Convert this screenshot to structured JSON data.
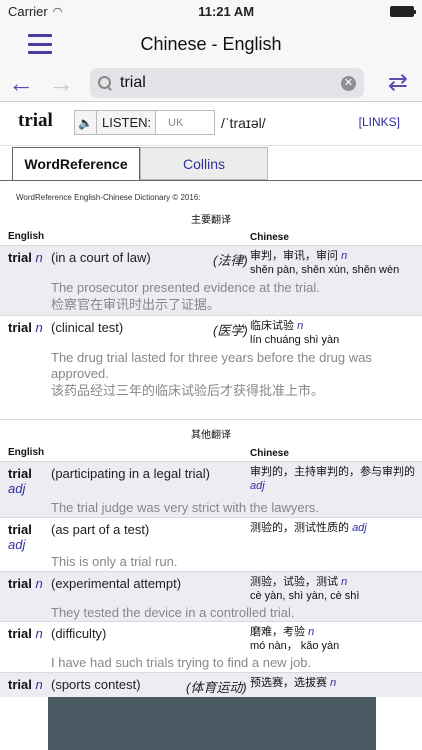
{
  "status": {
    "carrier": "Carrier",
    "time": "11:21 AM"
  },
  "nav": {
    "title": "Chinese - English"
  },
  "search": {
    "query": "trial"
  },
  "headword": {
    "word": "trial",
    "listen_label": "LISTEN:",
    "accent": "UK",
    "ipa": "/ˈtraɪəl/",
    "links": "[LINKS]"
  },
  "tabs": [
    {
      "label": "WordReference"
    },
    {
      "label": "Collins"
    }
  ],
  "credit": "WordReference English-Chinese Dictionary © 2016:",
  "main_section": {
    "title": "主要翻译",
    "col_en": "English",
    "col_zh": "Chinese",
    "entries": [
      {
        "term": "trial",
        "pos": "n",
        "sense": "(in a court of law)",
        "domain": "(法律)",
        "zh": "审判，审讯，审问",
        "zh_pos": "n",
        "pinyin": "shěn pàn, shěn xùn, shěn wèn",
        "example_en": "The prosecutor presented evidence at the trial.",
        "example_zh": "检察官在审讯时出示了证据。"
      },
      {
        "term": "trial",
        "pos": "n",
        "sense": "(clinical test)",
        "domain": "(医学)",
        "zh": "临床试验",
        "zh_pos": "n",
        "pinyin": "lín chuáng shì yàn",
        "example_en": "The drug trial lasted for three years before the drug was approved.",
        "example_zh": "该药品经过三年的临床试验后才获得批准上市。"
      }
    ]
  },
  "other_section": {
    "title": "其他翻译",
    "col_en": "English",
    "col_zh": "Chinese",
    "entries": [
      {
        "term": "trial",
        "pos": "adj",
        "sense": "(participating in a legal trial)",
        "zh": "审判的，主持审判的，参与审判的",
        "zh_pos": "adj",
        "example_en": "The trial judge was very strict with the lawyers."
      },
      {
        "term": "trial",
        "pos": "adj",
        "sense": "(as part of a test)",
        "zh": "测验的，测试性质的",
        "zh_pos": "adj",
        "example_en": "This is only a trial run."
      },
      {
        "term": "trial",
        "pos": "n",
        "sense": "(experimental attempt)",
        "zh": "测验，试验，测试",
        "zh_pos": "n",
        "pinyin": "cè yàn, shì yàn, cè shì",
        "example_en": "They tested the device in a controlled trial."
      },
      {
        "term": "trial",
        "pos": "n",
        "sense": "(difficulty)",
        "zh": "磨难，考验",
        "zh_pos": "n",
        "pinyin": "mó nàn， kǎo yàn",
        "example_en": "I have had such trials trying to find a new job."
      },
      {
        "term": "trial",
        "pos": "n",
        "sense": "(sports contest)",
        "domain": "(体育运动)",
        "zh": "预选赛，选拔赛",
        "zh_pos": "n"
      }
    ]
  }
}
